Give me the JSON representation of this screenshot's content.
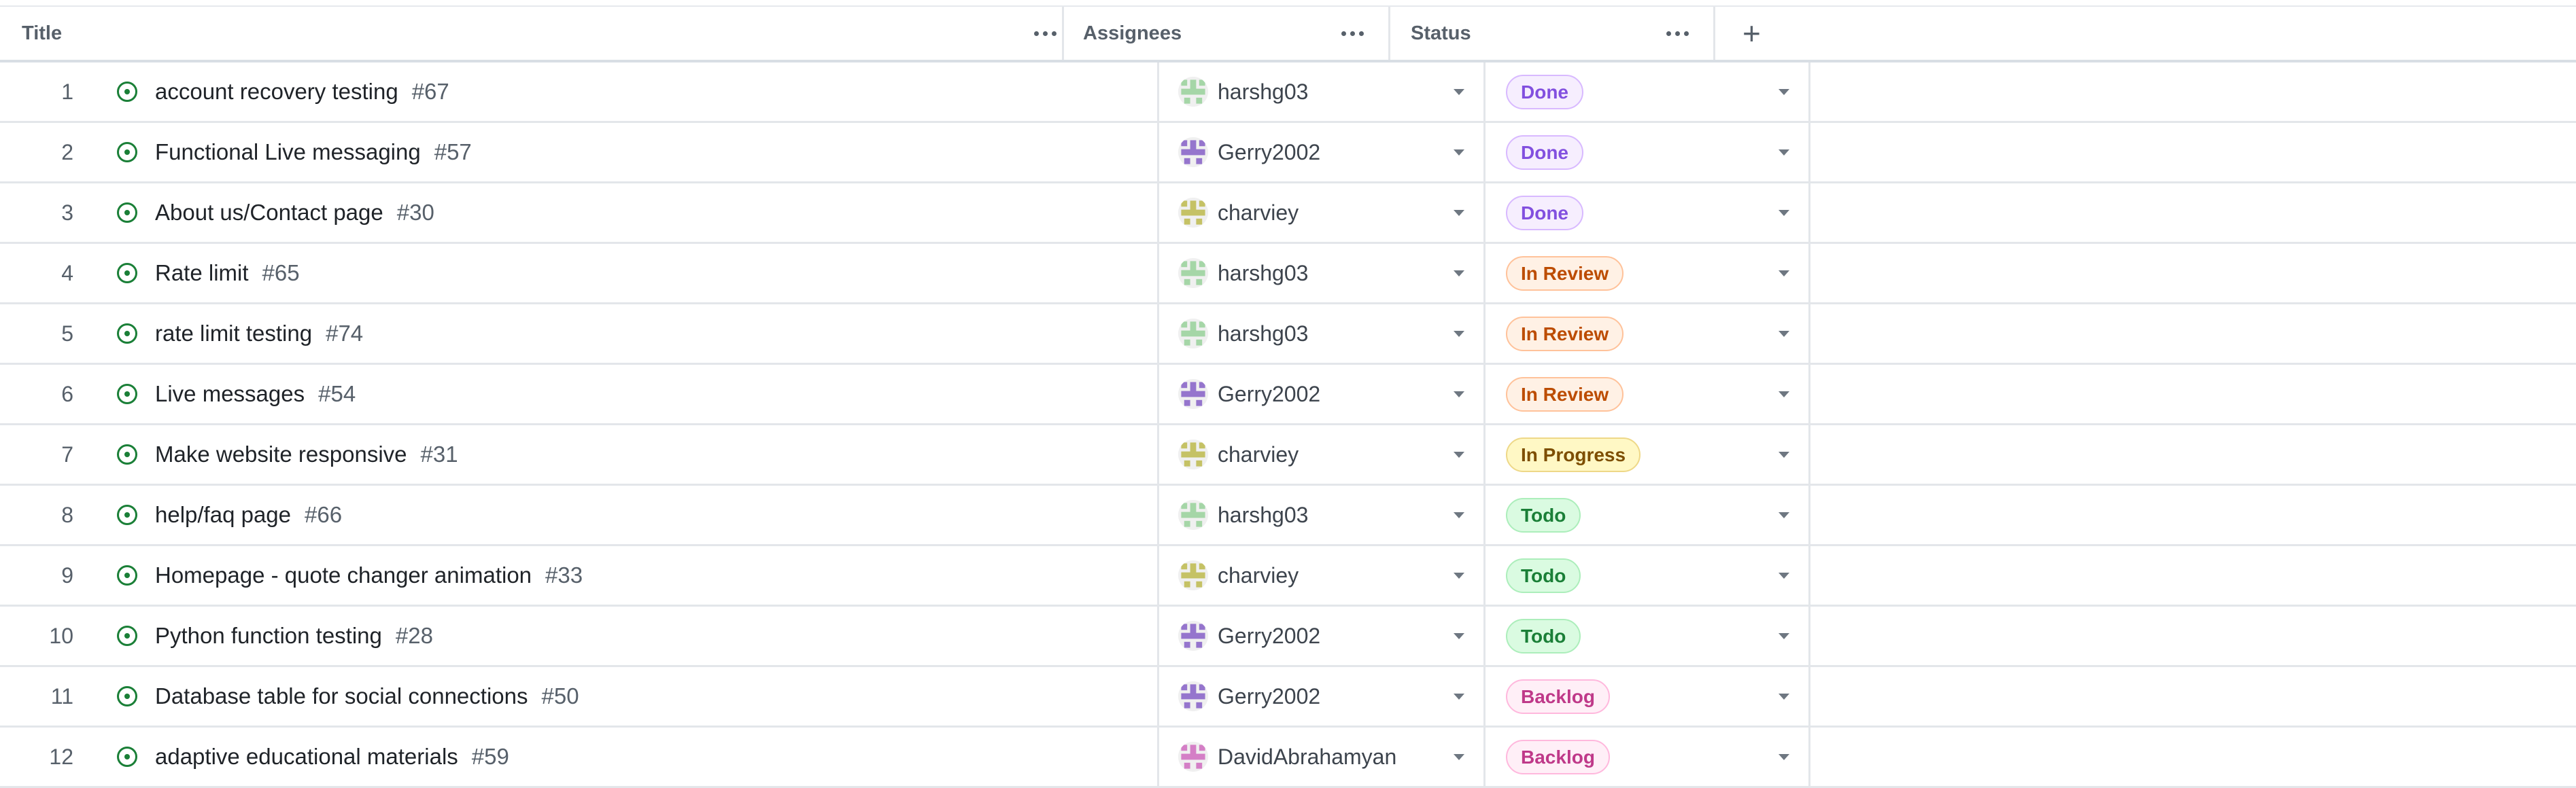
{
  "columns": {
    "title": "Title",
    "assignees": "Assignees",
    "status": "Status",
    "add_label": "+"
  },
  "colors": {
    "issue_open": "#1a7f37",
    "Done": "#8250df",
    "In Review": "#bc4c00",
    "In Progress": "#7d4e00",
    "Todo": "#1a7f37",
    "Backlog": "#bf3989"
  },
  "avatars": {
    "harshg03": "#a5d6a7",
    "Gerry2002": "#9575cd",
    "charviey": "#c5c265",
    "DavidAbrahamyan": "#d47fc6"
  },
  "rows": [
    {
      "num": "1",
      "title": "account recovery testing",
      "issue": "#67",
      "assignee": "harshg03",
      "status": "Done"
    },
    {
      "num": "2",
      "title": "Functional Live messaging",
      "issue": "#57",
      "assignee": "Gerry2002",
      "status": "Done"
    },
    {
      "num": "3",
      "title": "About us/Contact page",
      "issue": "#30",
      "assignee": "charviey",
      "status": "Done"
    },
    {
      "num": "4",
      "title": "Rate limit",
      "issue": "#65",
      "assignee": "harshg03",
      "status": "In Review"
    },
    {
      "num": "5",
      "title": "rate limit testing",
      "issue": "#74",
      "assignee": "harshg03",
      "status": "In Review"
    },
    {
      "num": "6",
      "title": "Live messages",
      "issue": "#54",
      "assignee": "Gerry2002",
      "status": "In Review"
    },
    {
      "num": "7",
      "title": "Make website responsive",
      "issue": "#31",
      "assignee": "charviey",
      "status": "In Progress"
    },
    {
      "num": "8",
      "title": "help/faq page",
      "issue": "#66",
      "assignee": "harshg03",
      "status": "Todo"
    },
    {
      "num": "9",
      "title": "Homepage - quote changer animation",
      "issue": "#33",
      "assignee": "charviey",
      "status": "Todo"
    },
    {
      "num": "10",
      "title": "Python function testing",
      "issue": "#28",
      "assignee": "Gerry2002",
      "status": "Todo"
    },
    {
      "num": "11",
      "title": "Database table for social connections",
      "issue": "#50",
      "assignee": "Gerry2002",
      "status": "Backlog"
    },
    {
      "num": "12",
      "title": "adaptive educational materials",
      "issue": "#59",
      "assignee": "DavidAbrahamyan",
      "status": "Backlog"
    }
  ]
}
